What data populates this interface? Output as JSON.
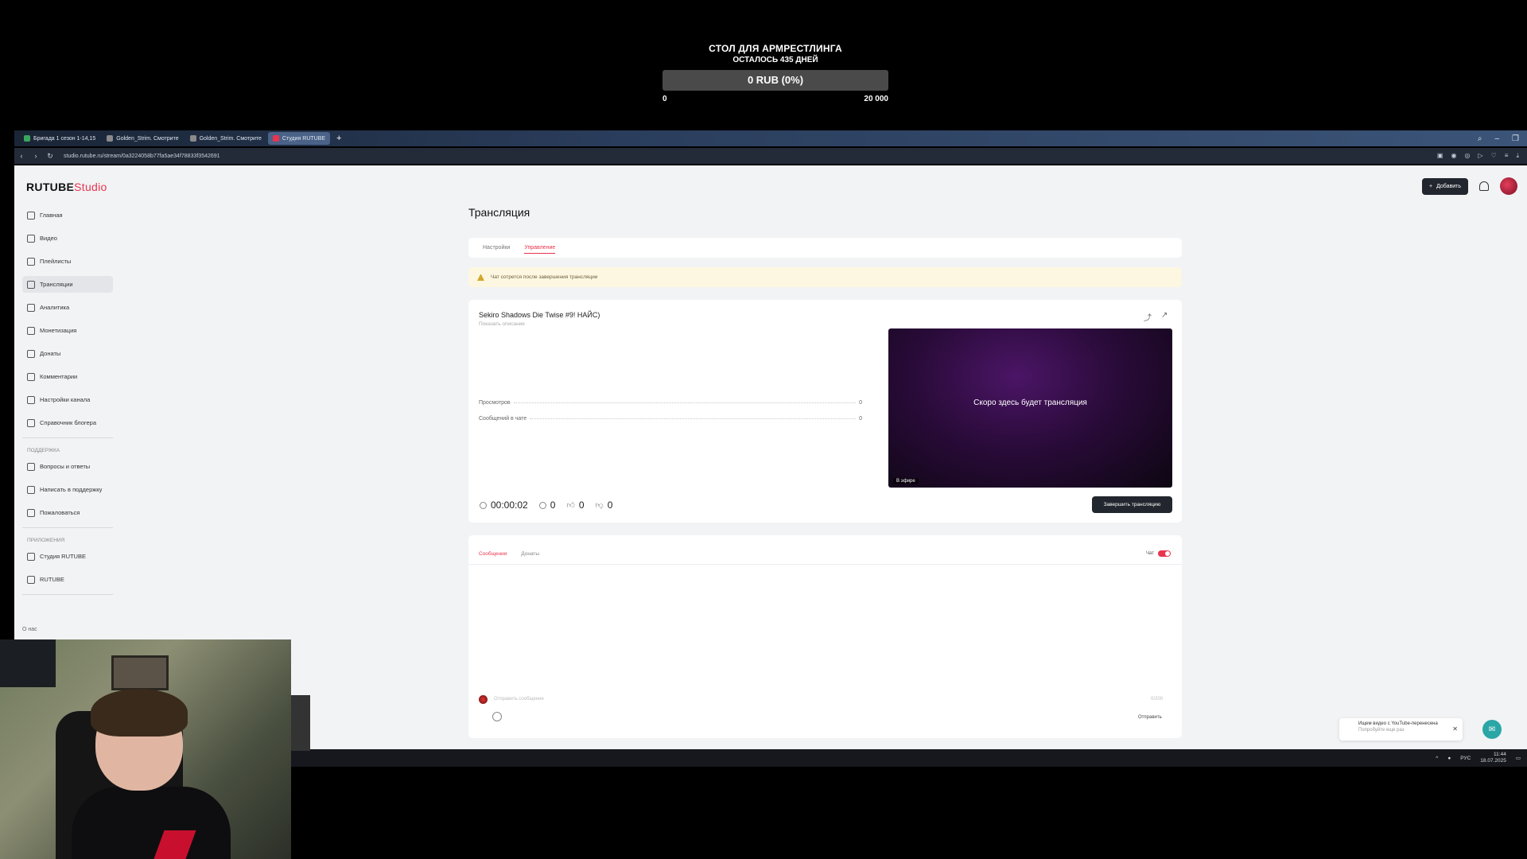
{
  "goal": {
    "title": "СТОЛ ДЛЯ АРМРЕСТЛИНГА",
    "subtitle": "ОСТАЛОСЬ 435 ДНЕЙ",
    "amount_label": "0 RUB (0%)",
    "progress_fraction": 0,
    "min": "0",
    "max": "20 000"
  },
  "browser": {
    "tabs": [
      {
        "label": "Бригада 1 сезон 1-14,15",
        "active": false,
        "color": "#3ba55c"
      },
      {
        "label": "Golden_Strim. Смотрите",
        "active": false,
        "color": "#8a8a8a"
      },
      {
        "label": "Golden_Strim. Смотрите",
        "active": false,
        "color": "#8a8a8a"
      },
      {
        "label": "Студия RUTUBE",
        "active": true,
        "color": "#e8344e"
      }
    ],
    "url": "studio.rutube.ru/stream/0a3224058b77fa5ae34f78833f3542691"
  },
  "app": {
    "logo_main": "RUTUBE",
    "logo_studio": "Studio",
    "add_button": "Добавить",
    "accent": "#e8344e"
  },
  "sidebar": {
    "items": [
      {
        "label": "Главная",
        "icon": "home-icon"
      },
      {
        "label": "Видео",
        "icon": "video-icon"
      },
      {
        "label": "Плейлисты",
        "icon": "playlist-icon"
      },
      {
        "label": "Трансляции",
        "icon": "broadcast-icon",
        "active": true
      },
      {
        "label": "Аналитика",
        "icon": "analytics-icon"
      },
      {
        "label": "Монетизация",
        "icon": "monetization-icon"
      },
      {
        "label": "Донаты",
        "icon": "donate-icon"
      },
      {
        "label": "Комментарии",
        "icon": "comment-icon"
      },
      {
        "label": "Настройки канала",
        "icon": "settings-icon"
      },
      {
        "label": "Справочник блогера",
        "icon": "info-icon"
      }
    ],
    "support_title": "ПОДДЕРЖКА",
    "support_items": [
      {
        "label": "Вопросы и ответы",
        "icon": "help-icon"
      },
      {
        "label": "Написать в поддержку",
        "icon": "mail-icon"
      },
      {
        "label": "Пожаловаться",
        "icon": "flag-icon"
      }
    ],
    "apps_title": "ПРИЛОЖЕНИЯ",
    "apps_items": [
      {
        "label": "Студия RUTUBE",
        "icon": "app-icon"
      },
      {
        "label": "RUTUBE",
        "icon": "app-icon"
      }
    ],
    "about": "О нас"
  },
  "main": {
    "page_title": "Трансляция",
    "tabs": [
      {
        "label": "Настройки",
        "active": false
      },
      {
        "label": "Управление",
        "active": true
      }
    ],
    "warning": "Чат сотрется после завершения трансляции",
    "stream": {
      "title": "Sekiro Shadows Die Twise #9! НАЙС)",
      "description_placeholder": "Показать описание",
      "stats": [
        {
          "label": "Просмотров",
          "value": "0"
        },
        {
          "label": "Сообщений в чате",
          "value": "0"
        }
      ],
      "preview_text": "Скоро здесь будет трансляция",
      "live_badge": "В эфире",
      "duration": "00:00:02",
      "viewers": "0",
      "likes": "0",
      "dislikes": "0",
      "end_button": "Завершить трансляцию"
    },
    "chat": {
      "tabs": [
        {
          "label": "Сообщения",
          "active": true
        },
        {
          "label": "Донаты",
          "active": false
        }
      ],
      "toggle_label": "Чат",
      "input_placeholder": "Отправить сообщение",
      "counter": "0/200",
      "send_label": "Отправить"
    }
  },
  "toast": {
    "title": "Ищем видео с YouTube-перенесена",
    "subtitle": "Попробуйте еще раз"
  },
  "taskbar": {
    "lang": "РУС",
    "time": "11:44",
    "date": "18.07.2025"
  }
}
